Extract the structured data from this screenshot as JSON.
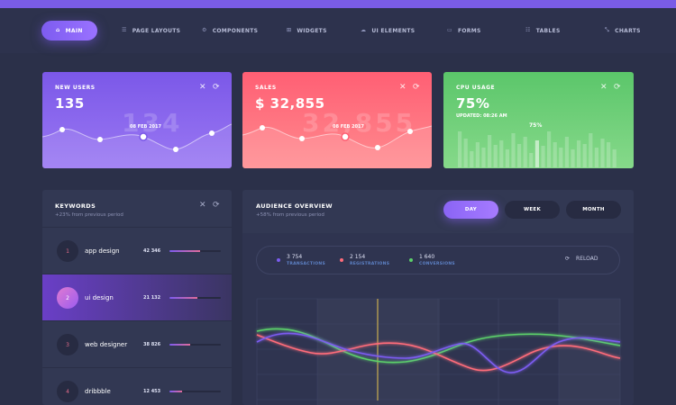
{
  "nav": {
    "items": [
      {
        "label": "MAIN",
        "icon": "home-icon",
        "glyph": "⌂",
        "active": true
      },
      {
        "label": "PAGE LAYOUTS",
        "icon": "layout-icon",
        "glyph": "☰",
        "active": false
      },
      {
        "label": "COMPONENTS",
        "icon": "components-icon",
        "glyph": "⚙",
        "active": false
      },
      {
        "label": "WIDGETS",
        "icon": "widgets-icon",
        "glyph": "⊞",
        "active": false
      },
      {
        "label": "UI ELEMENTS",
        "icon": "ui-elements-icon",
        "glyph": "☁",
        "active": false
      },
      {
        "label": "FORMS",
        "icon": "forms-icon",
        "glyph": "▭",
        "active": false
      },
      {
        "label": "TABLES",
        "icon": "tables-icon",
        "glyph": "☷",
        "active": false
      },
      {
        "label": "CHARTS",
        "icon": "charts-icon",
        "glyph": "⤡",
        "active": false
      }
    ]
  },
  "cards": {
    "new_users": {
      "title": "NEW USERS",
      "value": "135",
      "ghost": "134",
      "date": "08 FEB 2017",
      "colors": [
        "#7b58e8",
        "#9a78f3"
      ]
    },
    "sales": {
      "title": "SALES",
      "value": "$ 32,855",
      "ghost": "32,855",
      "date": "08 FEB 2017",
      "colors": [
        "#ff5f74",
        "#ff8a8e"
      ]
    },
    "cpu": {
      "title": "CPU USAGE",
      "value": "75%",
      "sub": "UPDATED: 08:26 AM",
      "bar_label": "75%",
      "colors": [
        "#5bc66a",
        "#86d98a"
      ]
    }
  },
  "card_controls": {
    "close_glyph": "✕",
    "refresh_glyph": "⟳"
  },
  "keywords": {
    "title": "KEYWORDS",
    "subtitle": "+23% from previous period",
    "rows": [
      {
        "num": "1",
        "label": "app design",
        "count": "42 346",
        "progress": 0.6
      },
      {
        "num": "2",
        "label": "ui design",
        "count": "21 132",
        "progress": 0.55
      },
      {
        "num": "3",
        "label": "web designer",
        "count": "38 826",
        "progress": 0.4
      },
      {
        "num": "4",
        "label": "dribbble",
        "count": "12 453",
        "progress": 0.25
      }
    ]
  },
  "audience": {
    "title": "AUDIENCE OVERVIEW",
    "subtitle": "+58% from previous period",
    "tabs": [
      "DAY",
      "WEEK",
      "MONTH"
    ],
    "active_tab": "DAY",
    "legend": [
      {
        "value": "3 754",
        "label": "TRANSACTIONS",
        "color": "#7b5cf0"
      },
      {
        "value": "2 154",
        "label": "REGISTRATIONS",
        "color": "#ff6c7a"
      },
      {
        "value": "1 640",
        "label": "CONVERSIONS",
        "color": "#5bd06a"
      }
    ],
    "reload_label": "RELOAD",
    "reload_glyph": "⟳"
  }
}
